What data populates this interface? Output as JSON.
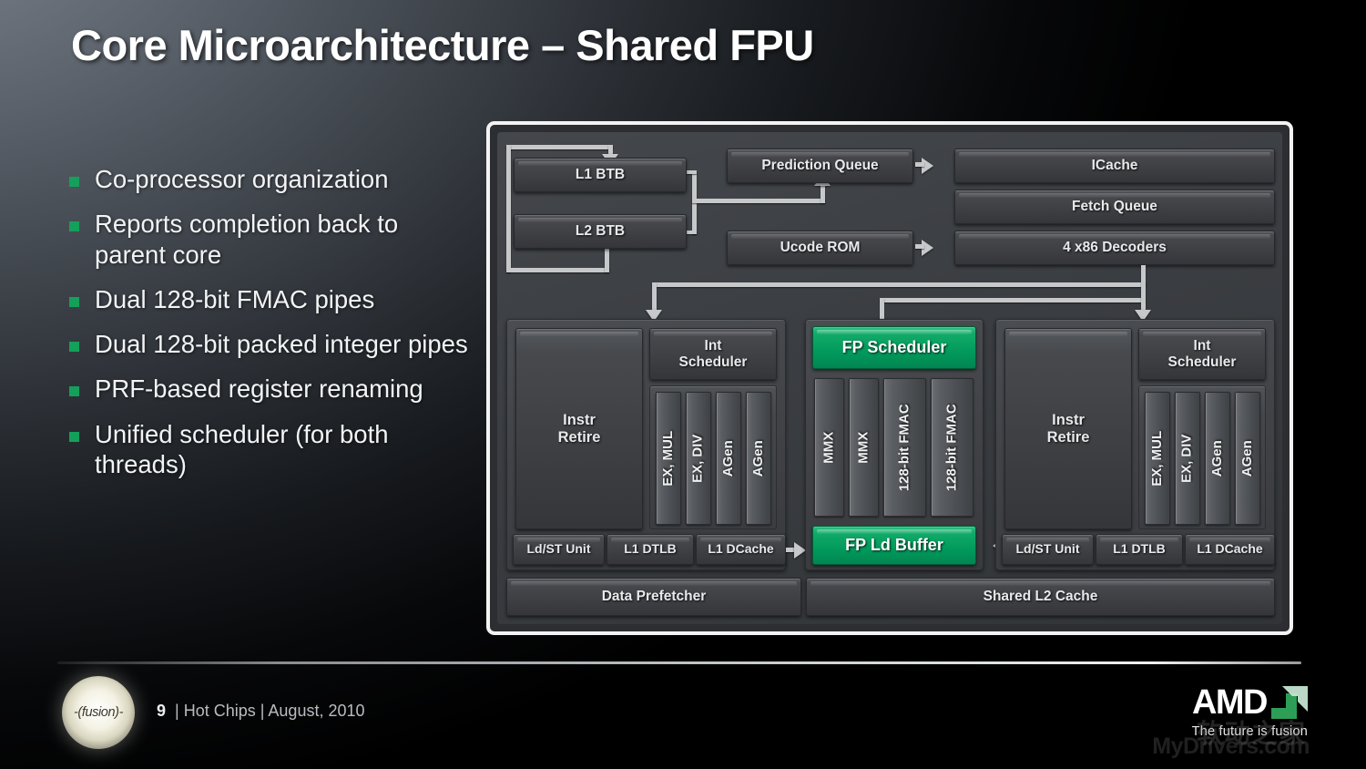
{
  "slide": {
    "title": "Core Microarchitecture – Shared FPU",
    "accent_green": "#019a5c",
    "bullet_marker_color": "#14a05a",
    "background_top_left": "#6d7680",
    "background_bottom_right": "#000000"
  },
  "bullets": [
    {
      "text": "Co-processor organization"
    },
    {
      "text": "Reports completion back to parent core"
    },
    {
      "text": "Dual 128-bit FMAC pipes"
    },
    {
      "text": "Dual 128-bit packed integer pipes"
    },
    {
      "text": "PRF-based register renaming"
    },
    {
      "text": "Unified scheduler (for both threads)"
    }
  ],
  "diagram": {
    "frontend": {
      "l1_btb": "L1 BTB",
      "l2_btb": "L2 BTB",
      "prediction_queue": "Prediction Queue",
      "ucode_rom": "Ucode ROM",
      "icache": "ICache",
      "fetch_queue": "Fetch Queue",
      "decoders": "4 x86 Decoders"
    },
    "core_left": {
      "instr_retire": "Instr\nRetire",
      "int_scheduler": "Int\nScheduler",
      "pipes": [
        "EX, MUL",
        "EX, DIV",
        "AGen",
        "AGen"
      ],
      "ldst_unit": "Ld/ST Unit",
      "l1_dtlb": "L1 DTLB",
      "l1_dcache": "L1 DCache"
    },
    "fpu": {
      "fp_scheduler": "FP Scheduler",
      "pipes": [
        "MMX",
        "MMX",
        "128-bit\nFMAC",
        "128-bit\nFMAC"
      ],
      "fp_ld_buffer": "FP Ld Buffer"
    },
    "core_right": {
      "instr_retire": "Instr\nRetire",
      "int_scheduler": "Int\nScheduler",
      "pipes": [
        "EX, MUL",
        "EX, DIV",
        "AGen",
        "AGen"
      ],
      "ldst_unit": "Ld/ST Unit",
      "l1_dtlb": "L1 DTLB",
      "l1_dcache": "L1 DCache"
    },
    "bottom": {
      "data_prefetcher": "Data Prefetcher",
      "shared_l2_cache": "Shared L2 Cache"
    }
  },
  "footer": {
    "logo_text": "-(fusion)-",
    "slide_number": "9",
    "separator": "|",
    "event": "Hot Chips",
    "date": "August, 2010",
    "full_text": "9 | Hot Chips | August, 2010"
  },
  "brand": {
    "name": "AMD",
    "tagline": "The future is fusion"
  },
  "watermark": {
    "line1": "软动之家",
    "line2": "MyDrivers.com"
  }
}
